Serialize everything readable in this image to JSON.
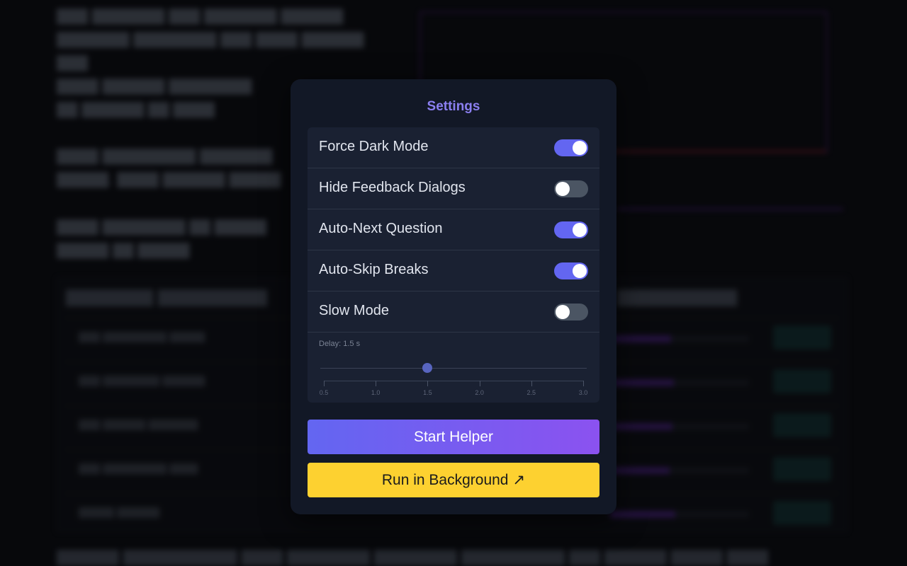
{
  "settings": {
    "title": "Settings",
    "toggles": [
      {
        "label": "Force Dark Mode",
        "on": true
      },
      {
        "label": "Hide Feedback Dialogs",
        "on": false
      },
      {
        "label": "Auto-Next Question",
        "on": true
      },
      {
        "label": "Auto-Skip Breaks",
        "on": true
      },
      {
        "label": "Slow Mode",
        "on": false
      }
    ],
    "delay": {
      "label": "Delay: 1.5 s",
      "value": 1.5,
      "min": 0.5,
      "max": 3.0,
      "ticks": [
        "0.5",
        "1.0",
        "1.5",
        "2.0",
        "2.5",
        "3.0"
      ]
    },
    "start_button": "Start Helper",
    "background_button": "Run in Background",
    "background_icon": "external-arrow-icon",
    "background_icon_glyph": "↗"
  },
  "colors": {
    "accent": "#6366f1",
    "title": "#8b7ff0",
    "yellow": "#fdd130",
    "toggle_off": "#4b5563"
  }
}
